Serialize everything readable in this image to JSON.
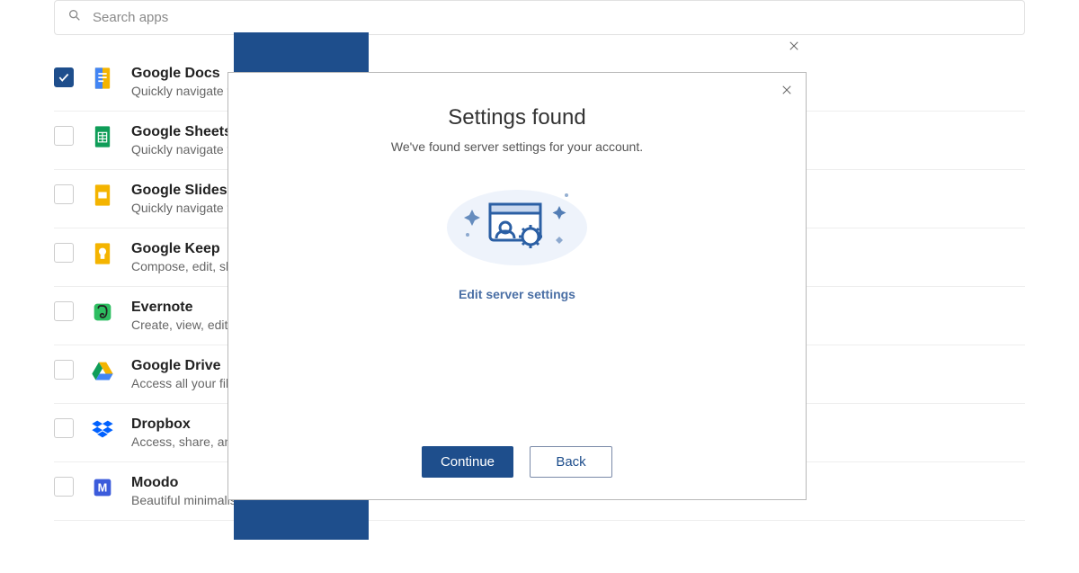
{
  "search": {
    "placeholder": "Search apps"
  },
  "apps": [
    {
      "id": "google-docs",
      "title": "Google Docs",
      "desc": "Quickly navigate to your documents",
      "checked": true
    },
    {
      "id": "google-sheets",
      "title": "Google Sheets",
      "desc": "Quickly navigate to your spreadsheets",
      "checked": false
    },
    {
      "id": "google-slides",
      "title": "Google Slides",
      "desc": "Quickly navigate to your presentations",
      "checked": false
    },
    {
      "id": "google-keep",
      "title": "Google Keep",
      "desc": "Compose, edit, share notes",
      "checked": false
    },
    {
      "id": "evernote",
      "title": "Evernote",
      "desc": "Create, view, edit notes",
      "checked": false
    },
    {
      "id": "google-drive",
      "title": "Google Drive",
      "desc": "Access all your files in one place",
      "checked": false
    },
    {
      "id": "dropbox",
      "title": "Dropbox",
      "desc": "Access, share, and organize files",
      "checked": false
    },
    {
      "id": "moodo",
      "title": "Moodo",
      "desc": "Beautiful minimalistic to-do",
      "checked": false
    }
  ],
  "modal": {
    "title": "Settings found",
    "subtitle": "We've found server settings for your account.",
    "edit_link": "Edit server settings",
    "continue": "Continue",
    "back": "Back"
  }
}
